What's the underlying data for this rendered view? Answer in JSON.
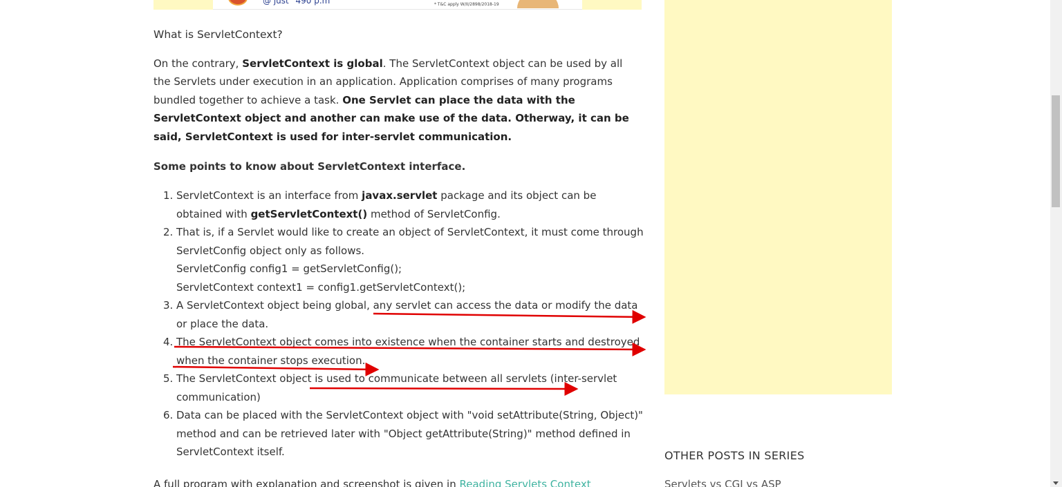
{
  "ad_banner": {
    "text": "@ just `490 p.m",
    "tbc": "* T&C apply W/II/2898/2018-19"
  },
  "article": {
    "heading": "What is ServletContext?",
    "para1": {
      "t1": "On the contrary, ",
      "b1": "ServletContext is global",
      "t2": ". The ServletContext object can be used by all the Servlets under execution in an application. Application comprises of many programs bundled together to achieve a task. ",
      "b2": "One Servlet can place the data with the ServletContext object and another can make use of the data. Otherway, it can be said, ServletContext is used for inter-servlet communication."
    },
    "para2": "Some points to know about ServletContext interface.",
    "points": [
      {
        "num": "1.",
        "t1": "ServletContext is an interface from ",
        "b1": "javax.servlet",
        "t2": " package and its object can be obtained with ",
        "b2": "getServletContext()",
        "t3": " method of ServletConfig."
      },
      {
        "num": "2.",
        "t1": "That is, if a Servlet would like to create an object of ServletContext, it must come through ServletConfig object only as follows.",
        "code1": "ServletConfig config1 = getServletConfig();",
        "code2": "ServletContext context1 = config1.getServletContext();"
      },
      {
        "num": "3.",
        "t1": "A ServletContext object being global, any servlet can access the data or modify the data or place the data."
      },
      {
        "num": "4.",
        "t1": "The ServletContext object comes into existence when the container starts and destroyed when the container stops execution."
      },
      {
        "num": "5.",
        "t1": "The ServletContext object is used to communicate between all servlets (inter-servlet communication)"
      },
      {
        "num": "6.",
        "t1": "Data can be placed with the ServletContext object with \"void setAttribute(String, Object)\" method and can be retrieved later with \"Object getAttribute(String)\" method defined in ServletContext itself."
      }
    ],
    "para3": {
      "t1": "A full program with explanation and screenshot is given in ",
      "link": "Reading Servlets Context"
    }
  },
  "sidebar": {
    "series_title": "OTHER POSTS IN SERIES",
    "first_post": "Servlets vs CGI vs ASP"
  },
  "colors": {
    "ad_background": "#fff9c2",
    "link": "#3fb3a0",
    "annotation_arrow": "#e00000"
  }
}
